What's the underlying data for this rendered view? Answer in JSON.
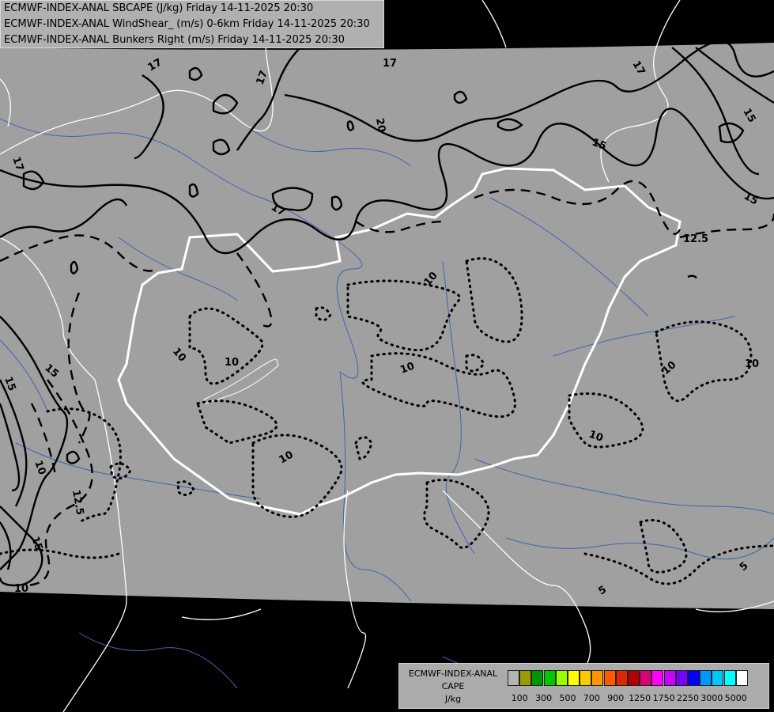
{
  "titles": [
    "ECMWF-INDEX-ANAL SBCAPE (J/kg) Friday 14-11-2025 20:30",
    "ECMWF-INDEX-ANAL WindShear_ (m/s) 0-6km Friday 14-11-2025 20:30",
    "ECMWF-INDEX-ANAL Bunkers Right (m/s) Friday 14-11-2025 20:30"
  ],
  "legend": {
    "line1": "ECMWF-INDEX-ANAL",
    "line2": "CAPE",
    "line3": "J/kg",
    "colors": [
      "#b4b4b4",
      "#9b9b00",
      "#009600",
      "#00c800",
      "#96ff00",
      "#ffff00",
      "#ffc800",
      "#ff9600",
      "#ff5a00",
      "#dc2800",
      "#b40000",
      "#dc0078",
      "#ff00ff",
      "#c800ff",
      "#7800ff",
      "#0000ff",
      "#0096ff",
      "#00c8ff",
      "#00ffff",
      "#ffffff"
    ],
    "ticks": [
      "100",
      "300",
      "500",
      "700",
      "900",
      "1250",
      "1750",
      "2250",
      "3000",
      "5000"
    ]
  },
  "contour_labels": {
    "shear": [
      "17",
      "17",
      "20",
      "17",
      "17",
      "15",
      "17",
      "15",
      "15",
      "12.5",
      "15",
      "17",
      "10",
      "12.5",
      "15",
      "15",
      "10"
    ],
    "bunkers": [
      "10",
      "10",
      "10",
      "10",
      "10",
      "10",
      "10",
      "5",
      "10",
      "5"
    ]
  },
  "style": {
    "domain_fill": "#a0a0a0",
    "background": "#000000",
    "borders": "#ffffff",
    "rivers": "#3c64b4"
  }
}
